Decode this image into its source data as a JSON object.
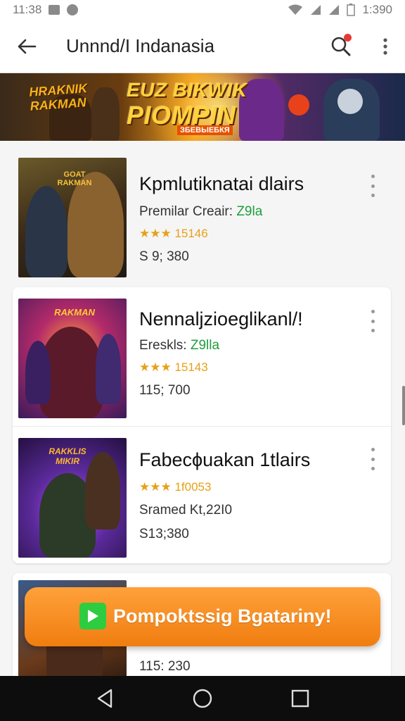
{
  "status_bar": {
    "time": "11:38",
    "clock": "1:390",
    "icons": [
      "notification-box-icon",
      "notification-circle-icon",
      "wifi-icon",
      "signal-icon",
      "signal-icon",
      "battery-icon"
    ]
  },
  "app_bar": {
    "title": "Unnnd/I Indanasia",
    "icons": [
      "back-arrow-icon",
      "search-icon",
      "more-vert-icon"
    ],
    "search_badge_color": "#e53935"
  },
  "banner": {
    "left_text_line1": "HRAKNIK",
    "left_text_line2": "RAKMAN",
    "title_line1": "EUZ BIKWIK",
    "title_line2": "PIOMPIN",
    "subtitle": "ЗБЕВЫЕБКЯ"
  },
  "items": [
    {
      "title": "Kpmlutiknatai dlairs",
      "subtitle_prefix": "Premilar Creair: ",
      "subtitle_highlight": "Z9la",
      "rating": "★★★ 15146",
      "price": "S 9; 380",
      "thumb_text": "GOAT RAKMAN"
    },
    {
      "title": "Nennaljzioeglikanl/!",
      "subtitle_prefix": "Ereskls: ",
      "subtitle_highlight": "Z9lla",
      "rating": "★★★ 15143",
      "price": "115; 700",
      "thumb_text": "RAKMAN"
    },
    {
      "title": "Fabecϕuakan 1tlairs",
      "subtitle_prefix": "",
      "subtitle_highlight": "",
      "rating": "★★★ 1f0053",
      "line2": "Sramed Kt,22I0",
      "price": "S13;380",
      "thumb_text": "RAKKLIS MIKIR"
    },
    {
      "title": "",
      "price": "115: 230"
    }
  ],
  "cta": {
    "label": "Pompoktssig Bgatariny!",
    "colors": {
      "top": "#ffa13a",
      "bottom": "#f07d10",
      "play": "#2ecc40"
    }
  },
  "nav": {
    "icons": [
      "nav-back-icon",
      "nav-home-icon",
      "nav-recents-icon"
    ]
  },
  "colors": {
    "highlight_green": "#1e9e3e",
    "star": "#e6a117"
  }
}
